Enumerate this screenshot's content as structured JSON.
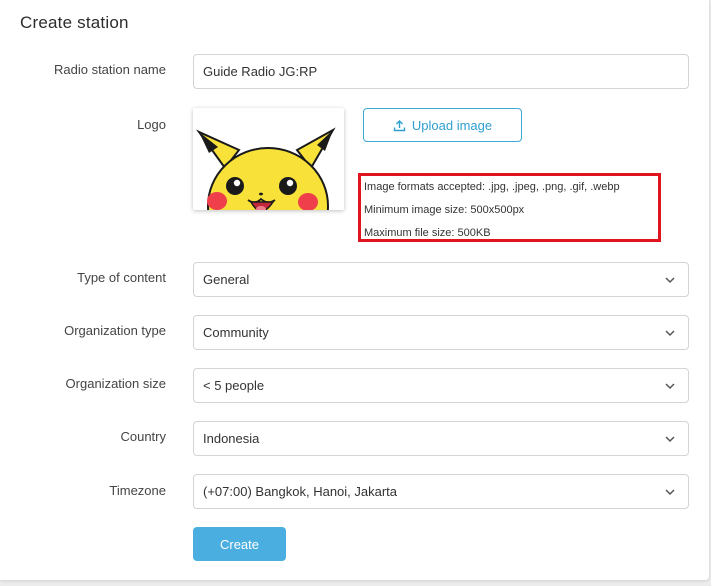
{
  "form": {
    "title": "Create station",
    "radio_station_name": {
      "label": "Radio station name",
      "value": "Guide Radio JG:RP"
    },
    "logo": {
      "label": "Logo",
      "image_icon": "pikachu-logo-image",
      "upload_button_label": "Upload image",
      "upload_icon": "upload-icon",
      "info": {
        "formats": "Image formats accepted: .jpg, .jpeg, .png, .gif, .webp",
        "min_size": "Minimum image size: 500x500px",
        "max_file": "Maximum file size: 500KB"
      },
      "highlight_color": "#e0141e"
    },
    "type_of_content": {
      "label": "Type of content",
      "value": "General"
    },
    "organization_type": {
      "label": "Organization type",
      "value": "Community"
    },
    "organization_size": {
      "label": "Organization size",
      "value": "< 5 people"
    },
    "country": {
      "label": "Country",
      "value": "Indonesia"
    },
    "timezone": {
      "label": "Timezone",
      "value": "(+07:00) Bangkok, Hanoi, Jakarta"
    },
    "create_button_label": "Create",
    "accent_color": "#4aaee0"
  }
}
